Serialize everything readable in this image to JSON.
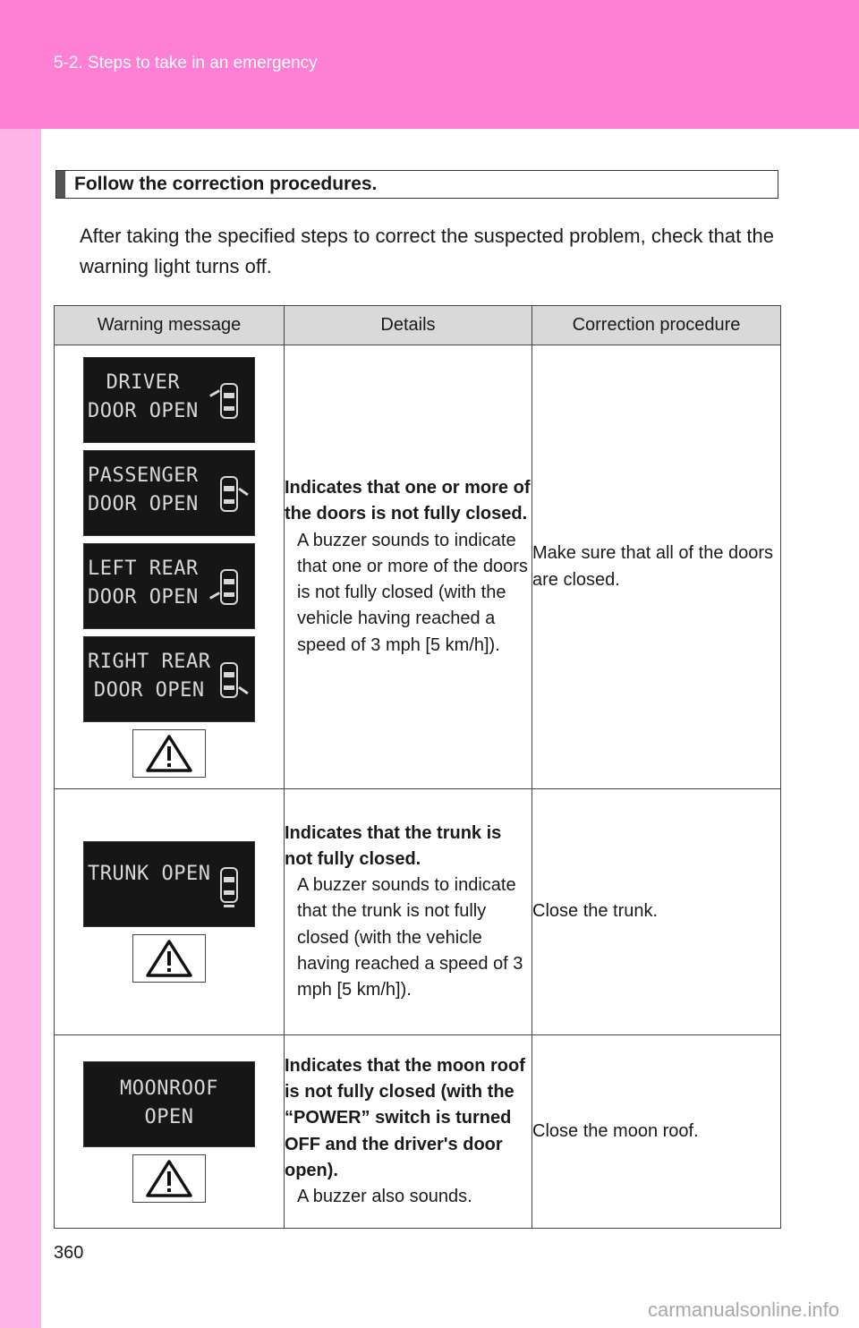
{
  "header": {
    "section": "5-2. Steps to take in an emergency"
  },
  "section_title": "Follow the correction procedures.",
  "intro": "After taking the specified steps to correct the suspected problem, check that the warning light turns off.",
  "table": {
    "headers": [
      "Warning message",
      "Details",
      "Correction procedure"
    ],
    "rows": [
      {
        "displays": [
          {
            "line1": "DRIVER",
            "line2": "DOOR OPEN"
          },
          {
            "line1": "PASSENGER",
            "line2": "DOOR OPEN"
          },
          {
            "line1": "LEFT REAR",
            "line2": "DOOR OPEN"
          },
          {
            "line1": "RIGHT REAR",
            "line2": "DOOR OPEN"
          }
        ],
        "details_bold": "Indicates that one or more of the doors is not fully closed.",
        "details_note": "A buzzer sounds to indicate that one or more of the doors is not fully closed (with the vehicle having reached a speed of 3 mph [5 km/h]).",
        "procedure": "Make sure that all of the doors are closed."
      },
      {
        "displays": [
          {
            "line1": "TRUNK OPEN"
          }
        ],
        "details_bold": "Indicates that the trunk is not fully closed.",
        "details_note": "A buzzer sounds to indicate that the trunk is not fully closed (with the vehicle having reached a speed of 3 mph [5 km/h]).",
        "procedure": "Close the trunk."
      },
      {
        "displays": [
          {
            "line1": "MOONROOF",
            "line2": "OPEN"
          }
        ],
        "details_bold": "Indicates that the moon roof is not fully closed (with the “POWER” switch is turned OFF and the driver's door open).",
        "details_note": "A buzzer also sounds.",
        "procedure": "Close the moon roof."
      }
    ]
  },
  "page_number": "360",
  "watermark": "carmanualsonline.info",
  "colors": {
    "header": "#ff7fd5",
    "strip": "#ffb5e9",
    "table_header": "#d9d9d9"
  }
}
